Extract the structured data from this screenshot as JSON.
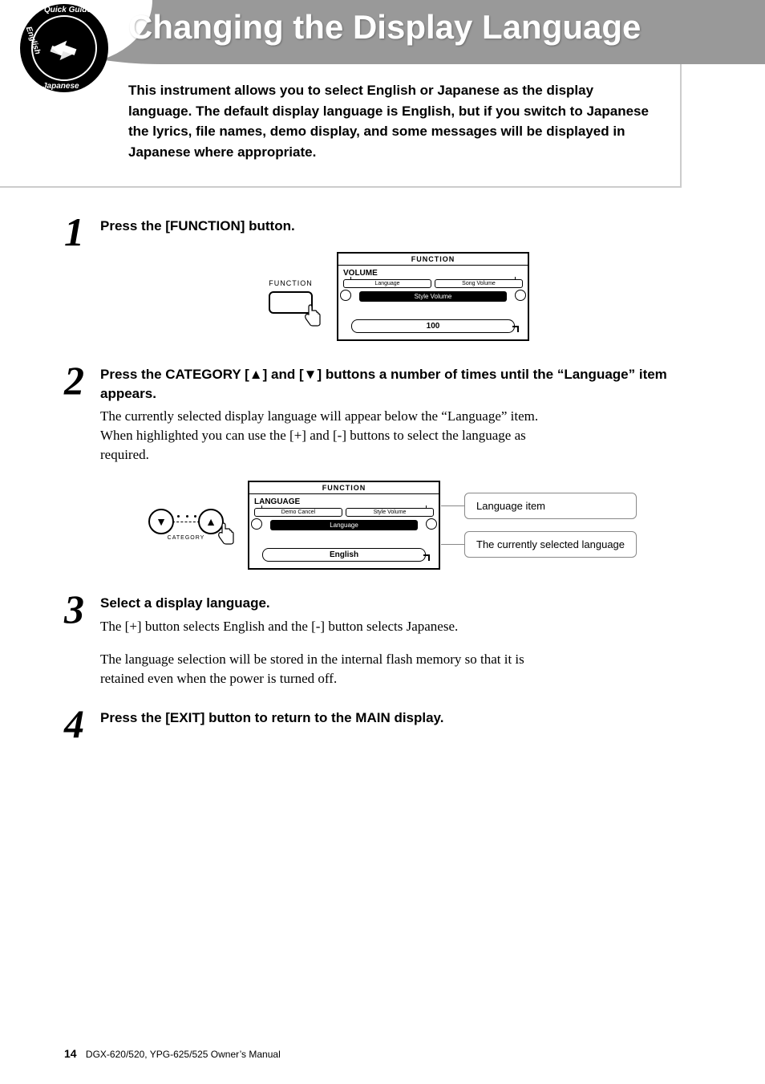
{
  "badge": {
    "top": "Quick Guide",
    "left": "English",
    "bottom": "Japanese"
  },
  "page_title": "Changing the Display Language",
  "intro": "This instrument allows you to select English or Japanese as the display language. The default display language is English, but if you switch to Japanese the lyrics, file names, demo display, and some messages will be displayed in Japanese where appropriate.",
  "steps": {
    "s1": {
      "num": "1",
      "title": "Press the [FUNCTION] button.",
      "button_label": "FUNCTION",
      "lcd": {
        "title": "FUNCTION",
        "heading": "VOLUME",
        "tab_left": "Language",
        "tab_right": "Song Volume",
        "center": "Style Volume",
        "value": "100"
      }
    },
    "s2": {
      "num": "2",
      "title_a": "Press the CATEGORY [",
      "title_b": "] and [",
      "title_c": "] buttons a number of times until the “Language” item appears.",
      "body_p1": "The currently selected display language will appear below the “Language” item.",
      "body_p2": "When highlighted you can use the [+] and [-] buttons to select the language as required.",
      "category_label": "CATEGORY",
      "lcd": {
        "title": "FUNCTION",
        "heading": "LANGUAGE",
        "tab_left": "Demo Cancel",
        "tab_right": "Style Volume",
        "center": "Language",
        "value": "English"
      },
      "callout1": "Language item",
      "callout2": "The currently selected language"
    },
    "s3": {
      "num": "3",
      "title": "Select a display language.",
      "body_p1": "The [+] button selects English and the [-] button selects Japanese.",
      "body_p2": "The language selection will be stored in the internal flash memory so that it is retained even when the power is turned off."
    },
    "s4": {
      "num": "4",
      "title": "Press the [EXIT] button to return to the MAIN display."
    }
  },
  "footer": {
    "page_num": "14",
    "doc": "DGX-620/520, YPG-625/525  Owner’s Manual"
  },
  "icons": {
    "up": "⬆",
    "down": "⬇",
    "hand": "☝"
  }
}
